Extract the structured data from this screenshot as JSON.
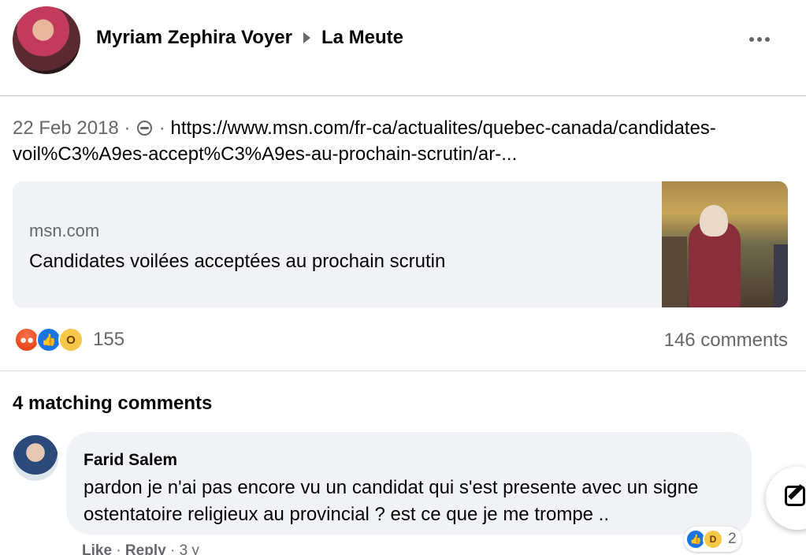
{
  "post": {
    "author": "Myriam Zephira Voyer",
    "group": "La Meute",
    "date": "22 Feb 2018",
    "separator": "·",
    "url": "https://www.msn.com/fr-ca/actualites/quebec-canada/candidates-voil%C3%A9es-accept%C3%A9es-au-prochain-scrutin/ar-...",
    "link_domain": "msn.com",
    "link_title": "Candidates voilées acceptées au prochain scrutin",
    "reaction_count": "155",
    "comments_count": "146 comments",
    "reaction_icons": [
      "angry-icon",
      "like-icon",
      "wow-icon"
    ]
  },
  "comments_section": {
    "heading": "4 matching comments",
    "comments": [
      {
        "author": "Farid Salem",
        "text": "pardon je n'ai pas encore vu un candidat qui s'est presente avec un signe ostentatoire religieux au provincial ? est ce que je me trompe ..",
        "reaction_count": "2",
        "reaction_icons": [
          "like-icon",
          "haha-icon"
        ],
        "like_label": "Like",
        "reply_label": "Reply",
        "time": "3 y"
      }
    ]
  },
  "colors": {
    "secondary_text": "#65676b",
    "bubble_bg": "#f0f2f5",
    "like_blue": "#1b74e4"
  }
}
